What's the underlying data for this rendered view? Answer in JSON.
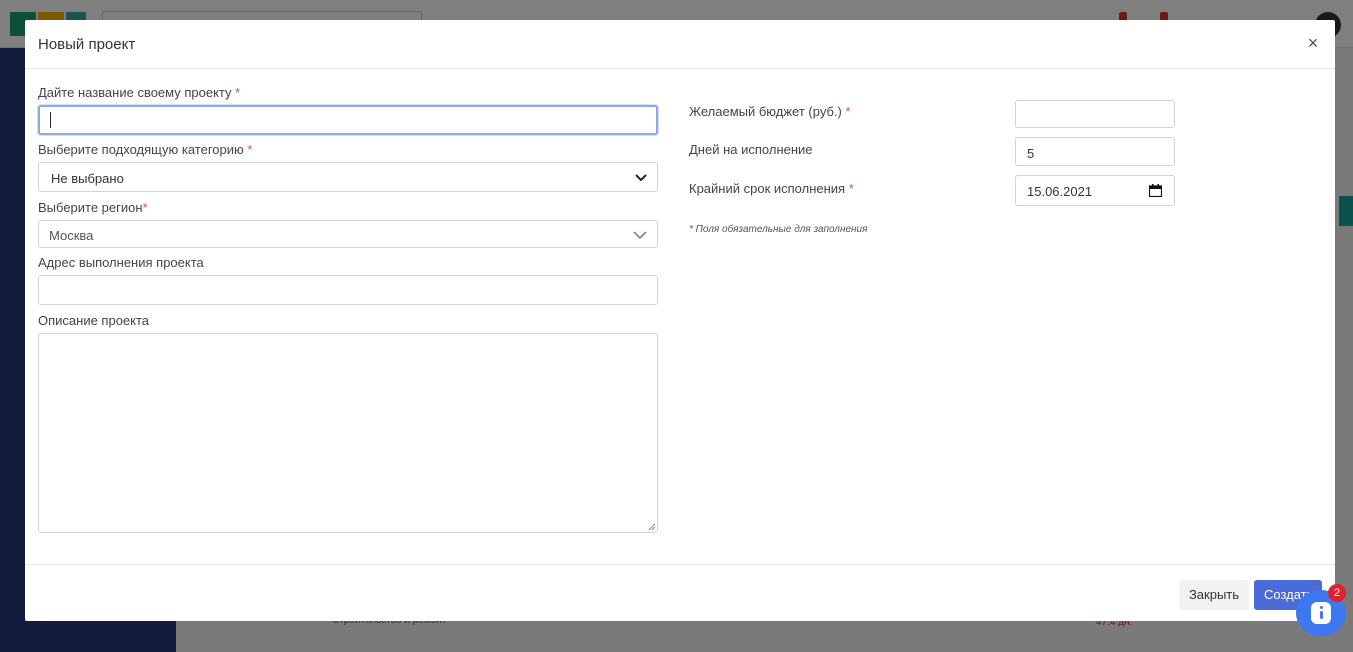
{
  "modal": {
    "title": "Новый проект",
    "close_icon": "close-icon",
    "required_mark": "*",
    "left": {
      "name_label": "Дайте название своему проекту",
      "name_value": "",
      "category_label": "Выберите подходящую категорию",
      "category_value": "Не выбрано",
      "region_label": "Выберите регион",
      "region_value": "Москва",
      "address_label": "Адрес выполнения проекта",
      "address_value": "",
      "description_label": "Описание проекта",
      "description_value": ""
    },
    "right": {
      "budget_label": "Желаемый бюджет (руб.)",
      "budget_value": "",
      "days_label": "Дней на исполнение",
      "days_value": "5",
      "deadline_label": "Крайний срок исполнения",
      "deadline_value": "15.06.2021",
      "required_note": "* Поля обязательные для заполнения"
    },
    "footer": {
      "close_label": "Закрыть",
      "create_label": "Создать"
    }
  },
  "background": {
    "row_category": "Строительство и ремонт",
    "row_days": "47.4 дн."
  },
  "chat": {
    "badge_count": "2",
    "icon": "chat-icon"
  },
  "colors": {
    "primary": "#4a6bd8",
    "required": "#d9534f",
    "sidebar": "#27367a",
    "focus": "#8ea7e6"
  }
}
